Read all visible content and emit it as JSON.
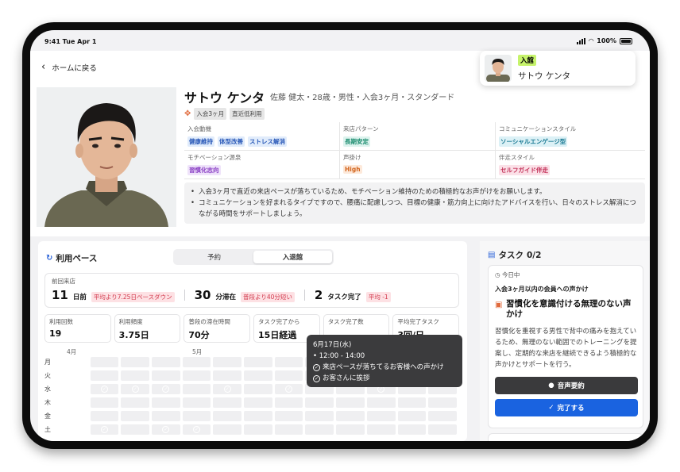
{
  "status_bar": {
    "time": "9:41  Tue Apr 1",
    "battery": "100%"
  },
  "header": {
    "back_label": "ホームに戻る"
  },
  "member_pill": {
    "badge": "入館",
    "name": "サトウ ケンタ"
  },
  "profile": {
    "name": "サトウ ケンタ",
    "subtitle": "佐藤 健太・28歳・男性・入会3ヶ月・スタンダード",
    "tags": [
      "入会3ヶ月",
      "直近低利用"
    ],
    "attributes": [
      {
        "label": "入会動機",
        "chips": [
          "健康維持",
          "体型改善",
          "ストレス解消"
        ],
        "color": "blue"
      },
      {
        "label": "来店パターン",
        "chips": [
          "長期安定"
        ],
        "color": "teal"
      },
      {
        "label": "コミュニケーションスタイル",
        "chips": [
          "ソーシャルエンゲージ型"
        ],
        "color": "cyan"
      },
      {
        "label": "モチベーション源泉",
        "chips": [
          "習慣化志向"
        ],
        "color": "purple"
      },
      {
        "label": "声掛け",
        "chips": [
          "High"
        ],
        "color": "orange"
      },
      {
        "label": "伴走スタイル",
        "chips": [
          "セルフガイド伴走"
        ],
        "color": "pink"
      }
    ],
    "notes": [
      "入会3ヶ月で直近の来店ペースが落ちているため、モチベーション維持のための積極的なお声がけをお願いします。",
      "コミュニケーションを好まれるタイプですので、腰痛に配慮しつつ、目標の健康・筋力向上に向けたアドバイスを行い、日々のストレス解消につながる時間をサポートしましょう。"
    ]
  },
  "usage": {
    "title": "利用ペース",
    "tabs": [
      "予約",
      "入退館"
    ],
    "active_tab": "入退館",
    "last_visit": {
      "label": "前回来店",
      "days_value": "11",
      "days_unit": "日前",
      "days_badge": "平均より7.25日ペースダウン",
      "stay_value": "30",
      "stay_unit": "分滞在",
      "stay_badge": "普段より40分短い",
      "tasks_value": "2",
      "tasks_unit": "タスク完了",
      "tasks_badge": "平均 -1"
    },
    "stats": [
      {
        "label": "利用回数",
        "value": "19"
      },
      {
        "label": "利用頻度",
        "value": "3.75日"
      },
      {
        "label": "普段の滞在時間",
        "value": "70分"
      },
      {
        "label": "タスク完了から",
        "value": "15日経過"
      },
      {
        "label": "タスク完了数",
        "value": ""
      },
      {
        "label": "平均完了タスク",
        "value": "3回/日"
      }
    ],
    "months": [
      "4月",
      "5月",
      "6月"
    ],
    "weekdays": [
      "月",
      "火",
      "水",
      "木",
      "金",
      "土"
    ],
    "heatmap": [
      [
        0,
        0,
        0,
        0,
        0,
        0,
        0,
        0,
        0,
        0,
        0,
        0
      ],
      [
        0,
        0,
        0,
        0,
        0,
        0,
        0,
        0,
        0,
        0,
        0,
        0
      ],
      [
        3,
        3,
        3,
        3,
        3,
        2,
        3,
        1,
        0,
        1,
        0,
        0
      ],
      [
        0,
        0,
        0,
        0,
        0,
        0,
        0,
        0,
        0,
        0,
        0,
        0
      ],
      [
        2,
        0,
        0,
        0,
        0,
        2,
        0,
        0,
        0,
        0,
        0,
        0
      ],
      [
        3,
        0,
        3,
        3,
        3,
        0,
        2,
        0,
        0,
        0,
        1,
        0
      ]
    ],
    "checks": [
      [
        0,
        0,
        0,
        0,
        0,
        0,
        0,
        0,
        0,
        0,
        0,
        0
      ],
      [
        0,
        0,
        0,
        0,
        0,
        0,
        0,
        0,
        0,
        0,
        0,
        0
      ],
      [
        1,
        1,
        1,
        0,
        1,
        0,
        1,
        0,
        0,
        1,
        0,
        0
      ],
      [
        0,
        0,
        0,
        0,
        0,
        0,
        0,
        0,
        0,
        0,
        0,
        0
      ],
      [
        0,
        0,
        0,
        0,
        0,
        0,
        0,
        0,
        0,
        0,
        0,
        0
      ],
      [
        1,
        0,
        1,
        1,
        0,
        0,
        0,
        0,
        0,
        0,
        0,
        0
      ]
    ],
    "tooltip": {
      "date": "6月17日(水)",
      "time": "• 12:00 - 14:00",
      "items": [
        "来店ペースが落ちてるお客様への声かけ",
        "お客さんに挨拶"
      ]
    }
  },
  "tasks": {
    "title": "タスク",
    "count": "0/2",
    "card": {
      "when": "今日中",
      "condition": "入会3ヶ月以内の会員への声かけ",
      "title": "習慣化を意識付ける無理のない声かけ",
      "description": "習慣化を重視する男性で背中の痛みを抱えているため、無理のない範囲でのトレーニングを提案し、定期的な来店を継続できるよう積極的な声かけとサポートを行う。",
      "voice_button": "音声要約",
      "done_button": "完了する"
    }
  },
  "colors": {
    "accent": "#1a63e0",
    "highlight": "#c6f36b",
    "dark_button": "#3a3a3c"
  }
}
